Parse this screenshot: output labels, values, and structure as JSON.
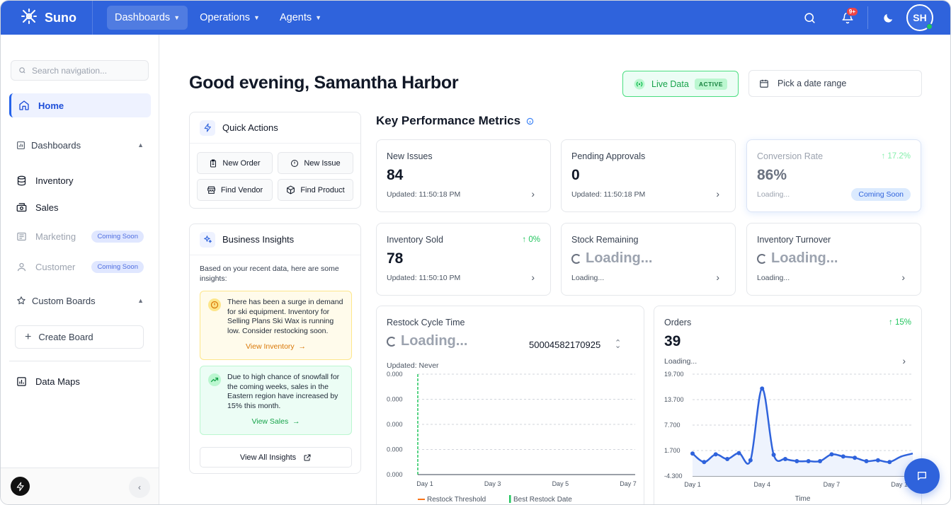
{
  "app": {
    "name": "Suno"
  },
  "topnav": {
    "items": [
      {
        "label": "Dashboards"
      },
      {
        "label": "Operations"
      },
      {
        "label": "Agents"
      }
    ],
    "notification_badge": "9+",
    "avatar_initials": "SH"
  },
  "sidebar": {
    "search_placeholder": "Search navigation...",
    "home": "Home",
    "dashboards_header": "Dashboards",
    "items": [
      {
        "label": "Inventory"
      },
      {
        "label": "Sales"
      },
      {
        "label": "Marketing",
        "badge": "Coming Soon"
      },
      {
        "label": "Customer",
        "badge": "Coming Soon"
      }
    ],
    "custom_boards_header": "Custom Boards",
    "create_board": "Create Board",
    "data_maps": "Data Maps"
  },
  "main": {
    "greeting": "Good evening, Samantha Harbor",
    "live_data": "Live Data",
    "live_status": "ACTIVE",
    "date_range_placeholder": "Pick a date range"
  },
  "quick_actions": {
    "title": "Quick Actions",
    "buttons": [
      "New Order",
      "New Issue",
      "Find Vendor",
      "Find Product"
    ]
  },
  "insights": {
    "title": "Business Insights",
    "intro": "Based on your recent data, here are some insights:",
    "items": [
      {
        "text": "There has been a surge in demand for ski equipment. Inventory for Selling Plans Ski Wax is running low. Consider restocking soon.",
        "link": "View Inventory"
      },
      {
        "text": "Due to high chance of snowfall for the coming weeks, sales in the Eastern region have increased by 15% this month.",
        "link": "View Sales"
      }
    ],
    "view_all": "View All Insights"
  },
  "kpi": {
    "title": "Key Performance Metrics",
    "cards": [
      {
        "label": "New Issues",
        "value": "84",
        "updated": "Updated: 11:50:18 PM"
      },
      {
        "label": "Pending Approvals",
        "value": "0",
        "updated": "Updated: 11:50:18 PM"
      },
      {
        "label": "Conversion Rate",
        "value": "86%",
        "updated": "Loading...",
        "change": "↑ 17.2%",
        "badge": "Coming Soon"
      },
      {
        "label": "Inventory Sold",
        "value": "78",
        "updated": "Updated: 11:50:10 PM",
        "change": "↑ 0%"
      },
      {
        "label": "Stock Remaining",
        "value": "Loading...",
        "updated": "Loading..."
      },
      {
        "label": "Inventory Turnover",
        "value": "Loading...",
        "updated": "Loading..."
      }
    ]
  },
  "restock": {
    "label": "Restock Cycle Time",
    "value": "Loading...",
    "id": "50004582170925",
    "updated": "Updated: Never"
  },
  "orders": {
    "label": "Orders",
    "value": "39",
    "change": "↑ 15%",
    "updated": "Loading..."
  },
  "chart_data": [
    {
      "type": "line",
      "categories": [
        "Day 1",
        "Day 3",
        "Day 5",
        "Day 7"
      ],
      "y_ticks": [
        "0.000",
        "0.000",
        "0.000",
        "0.000",
        "0.000"
      ],
      "series": [
        {
          "name": "Restock Threshold",
          "color": "#f97316",
          "values": []
        },
        {
          "name": "Best Restock Date",
          "color": "#22c55e",
          "values": []
        }
      ],
      "marker_x": "Day 1",
      "grid": true
    },
    {
      "type": "line",
      "categories": [
        "Day 1",
        "Day 4",
        "Day 7",
        "Day 10"
      ],
      "xlabel": "Time",
      "y_ticks": [
        "19.700",
        "13.700",
        "7.700",
        "1.700",
        "-4.300"
      ],
      "ylim": [
        -4.3,
        19.7
      ],
      "x": [
        1,
        1.5,
        2,
        2.5,
        3,
        3.5,
        4,
        4.5,
        5,
        5.5,
        6,
        6.5,
        7,
        7.5,
        8,
        8.5,
        9,
        9.5,
        10,
        10.5
      ],
      "series": [
        {
          "color": "#2f63dc",
          "values": [
            1.0,
            -1.0,
            0.8,
            -0.3,
            1.1,
            -0.6,
            16.3,
            0.7,
            -0.3,
            -0.8,
            -0.8,
            -0.8,
            0.8,
            0.3,
            0.0,
            -0.8,
            -0.6,
            -1.0,
            0.3,
            1.0
          ]
        }
      ],
      "grid": true
    }
  ]
}
